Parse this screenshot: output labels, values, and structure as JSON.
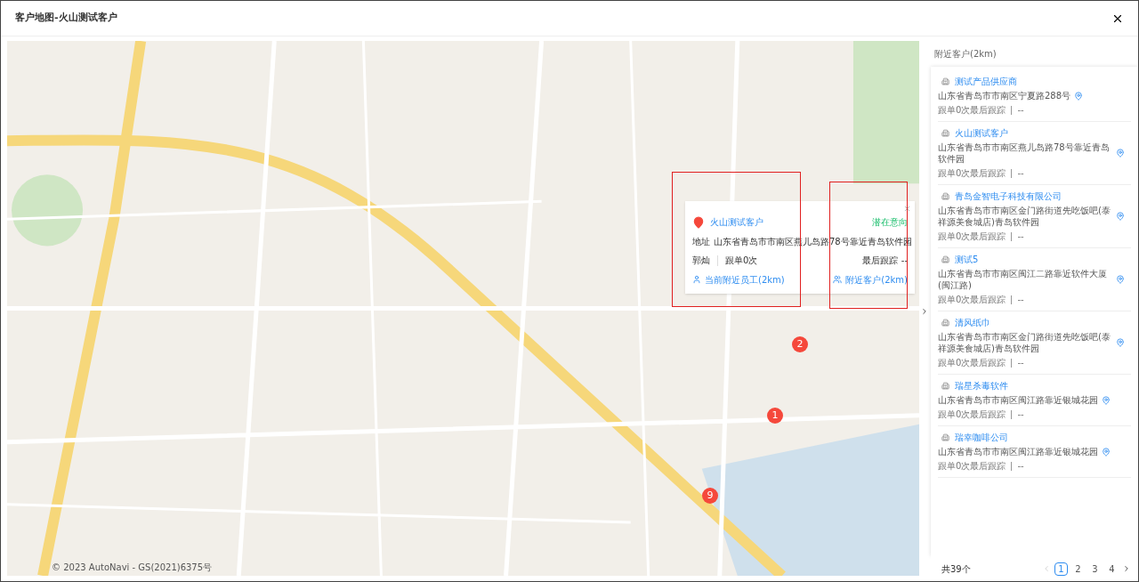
{
  "window": {
    "title": "客户地图-火山测试客户"
  },
  "map": {
    "copyright": "© 2023 AutoNavi - GS(2021)6375号",
    "markers": [
      {
        "label": "2"
      },
      {
        "label": "1"
      },
      {
        "label": "9"
      }
    ],
    "popup": {
      "name": "火山测试客户",
      "status": "潜在意向",
      "address_label": "地址",
      "address": "山东省青岛市市南区燕儿岛路78号靠近青岛软件园",
      "owner": "郭灿",
      "follow_count": "跟单0次",
      "last_follow_label": "最后跟踪",
      "last_follow": "--",
      "link_staff": "当前附近员工(2km)",
      "link_customers": "附近客户(2km)"
    }
  },
  "sidebar": {
    "title": "附近客户(2km)",
    "items": [
      {
        "name": "测试产品供应商",
        "address": "山东省青岛市市南区宁夏路288号",
        "follow": "跟单0次最后跟踪",
        "last": "--"
      },
      {
        "name": "火山测试客户",
        "address": "山东省青岛市市南区燕儿岛路78号靠近青岛软件园",
        "follow": "跟单0次最后跟踪",
        "last": "--"
      },
      {
        "name": "青岛金智电子科技有限公司",
        "address": "山东省青岛市市南区金门路街道先吃饭吧(泰祥源美食城店)青岛软件园",
        "follow": "跟单0次最后跟踪",
        "last": "--"
      },
      {
        "name": "测试5",
        "address": "山东省青岛市市南区闽江二路靠近软件大厦(闽江路)",
        "follow": "跟单0次最后跟踪",
        "last": "--"
      },
      {
        "name": "清风纸巾",
        "address": "山东省青岛市市南区金门路街道先吃饭吧(泰祥源美食城店)青岛软件园",
        "follow": "跟单0次最后跟踪",
        "last": "--"
      },
      {
        "name": "瑞星杀毒软件",
        "address": "山东省青岛市市南区闽江路靠近银城花园",
        "follow": "跟单0次最后跟踪",
        "last": "--"
      },
      {
        "name": "瑞幸咖啡公司",
        "address": "山东省青岛市市南区闽江路靠近银城花园",
        "follow": "跟单0次最后跟踪",
        "last": "--"
      }
    ],
    "total": "共39个",
    "prev_disabled": true,
    "pages": [
      {
        "label": "1",
        "selected": true
      },
      {
        "label": "2",
        "selected": false
      },
      {
        "label": "3",
        "selected": false
      },
      {
        "label": "4",
        "selected": false
      }
    ]
  }
}
